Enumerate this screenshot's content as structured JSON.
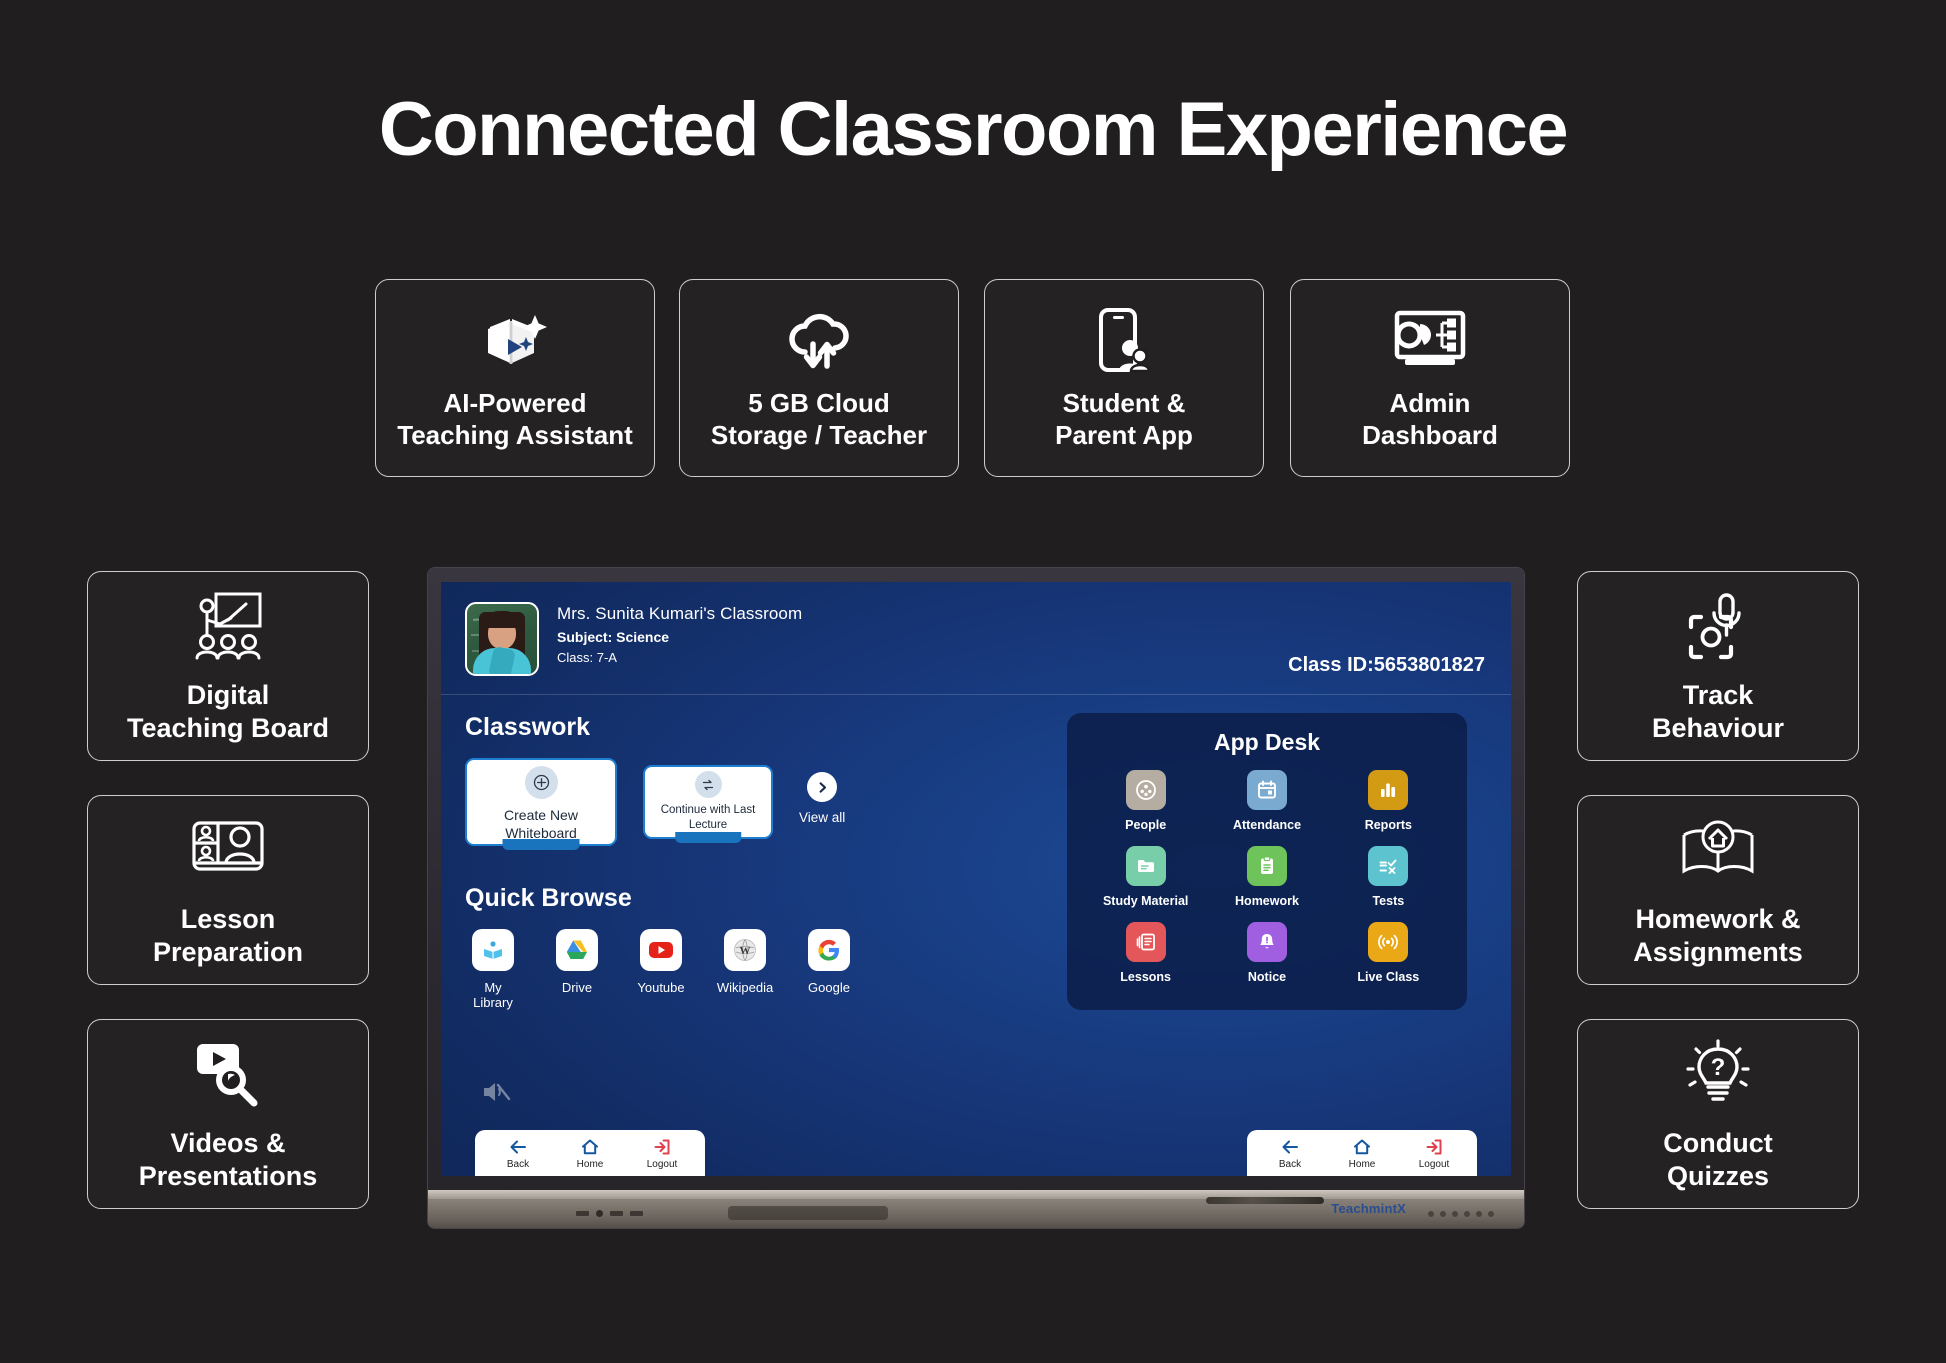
{
  "title": "Connected Classroom Experience",
  "theme": {
    "background": "#201e1e",
    "card_border": "#cfcdcd",
    "text": "#ffffff",
    "accent_blue": "#1e7fd0",
    "logout_red": "#e0414f"
  },
  "top_features": [
    {
      "icon": "ai-book-play-icon",
      "label": "AI-Powered\nTeaching Assistant"
    },
    {
      "icon": "cloud-sync-icon",
      "label": "5 GB Cloud\nStorage / Teacher"
    },
    {
      "icon": "phone-parent-student-icon",
      "label": "Student &\nParent App"
    },
    {
      "icon": "admin-dashboard-monitor-icon",
      "label": "Admin\nDashboard"
    }
  ],
  "left_features": [
    {
      "icon": "teacher-board-class-icon",
      "label": "Digital\nTeaching Board"
    },
    {
      "icon": "video-conference-grid-icon",
      "label": "Lesson\nPreparation"
    },
    {
      "icon": "video-search-icon",
      "label": "Videos &\nPresentations"
    }
  ],
  "right_features": [
    {
      "icon": "focus-scan-mic-icon",
      "label": "Track\nBehaviour"
    },
    {
      "icon": "open-book-home-icon",
      "label": "Homework &\nAssignments"
    },
    {
      "icon": "lightbulb-question-icon",
      "label": "Conduct\nQuizzes"
    }
  ],
  "display": {
    "brand": "TeachmintX",
    "header": {
      "teacher_name": "Mrs. Sunita Kumari's Classroom",
      "subject": "Subject: Science",
      "class": "Class: 7-A",
      "class_id": "Class ID:5653801827"
    },
    "classwork": {
      "title": "Classwork",
      "create_new": "Create New\nWhiteboard",
      "continue_last": "Continue with Last\nLecture",
      "view_all": "View all"
    },
    "quick_browse": {
      "title": "Quick Browse",
      "items": [
        {
          "icon": "my-library-icon",
          "label": "My Library"
        },
        {
          "icon": "google-drive-icon",
          "label": "Drive"
        },
        {
          "icon": "youtube-icon",
          "label": "Youtube"
        },
        {
          "icon": "wikipedia-icon",
          "label": "Wikipedia"
        },
        {
          "icon": "google-icon",
          "label": "Google"
        }
      ]
    },
    "app_desk": {
      "title": "App Desk",
      "items": [
        {
          "icon": "people-icon",
          "label": "People",
          "color": "#b5ada2"
        },
        {
          "icon": "calendar-icon",
          "label": "Attendance",
          "color": "#7aaacf"
        },
        {
          "icon": "bar-chart-icon",
          "label": "Reports",
          "color": "#d39a14"
        },
        {
          "icon": "folder-icon",
          "label": "Study Material",
          "color": "#79ceaa"
        },
        {
          "icon": "clipboard-icon",
          "label": "Homework",
          "color": "#6ec45a"
        },
        {
          "icon": "test-check-icon",
          "label": "Tests",
          "color": "#5cc3cf"
        },
        {
          "icon": "lessons-pages-icon",
          "label": "Lessons",
          "color": "#e3575a"
        },
        {
          "icon": "bell-alert-icon",
          "label": "Notice",
          "color": "#a05fe0"
        },
        {
          "icon": "live-broadcast-icon",
          "label": "Live Class",
          "color": "#eaa716"
        }
      ]
    },
    "nav": [
      {
        "icon": "back-arrow-icon",
        "label": "Back"
      },
      {
        "icon": "home-icon",
        "label": "Home"
      },
      {
        "icon": "logout-icon",
        "label": "Logout"
      }
    ],
    "mute_icon": "speaker-muted-icon"
  }
}
